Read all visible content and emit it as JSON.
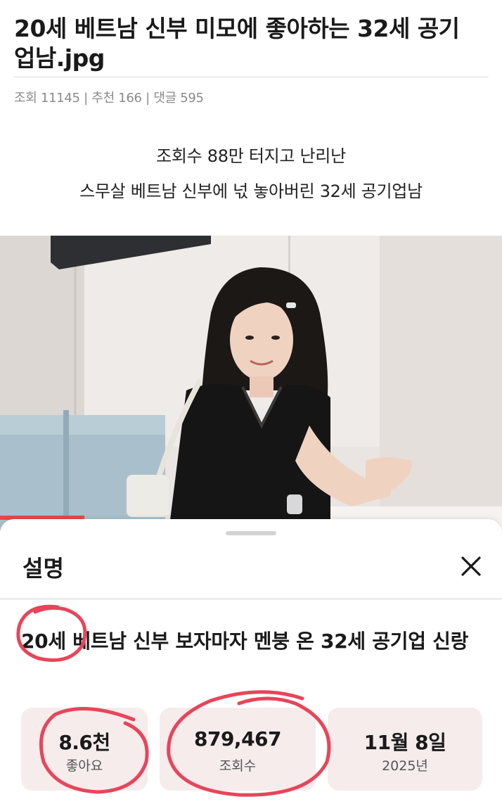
{
  "post": {
    "title": "20세 베트남 신부 미모에 좋아하는 32세 공기업남.jpg",
    "meta": "조회 11145 | 추천 166 | 댓글 595"
  },
  "caption": {
    "line1": "조회수 88만 터지고 난리난",
    "line2": "스무살 베트남 신부에 넋 놓아버린 32세 공기업남"
  },
  "sheet": {
    "title": "설명",
    "close_icon": "close-icon",
    "video_title": "20세 베트남 신부 보자마자 멘붕 온 32세 공기업 신랑",
    "stats": {
      "likes_value": "8.6천",
      "likes_label": "좋아요",
      "views_value": "879,467",
      "views_label": "조회수",
      "date_value": "11월 8일",
      "date_label": "2025년"
    }
  },
  "colors": {
    "annotation_red": "#e8455a",
    "stat_box_bg": "#f6ecec",
    "meta_gray": "#8a8a8a"
  }
}
